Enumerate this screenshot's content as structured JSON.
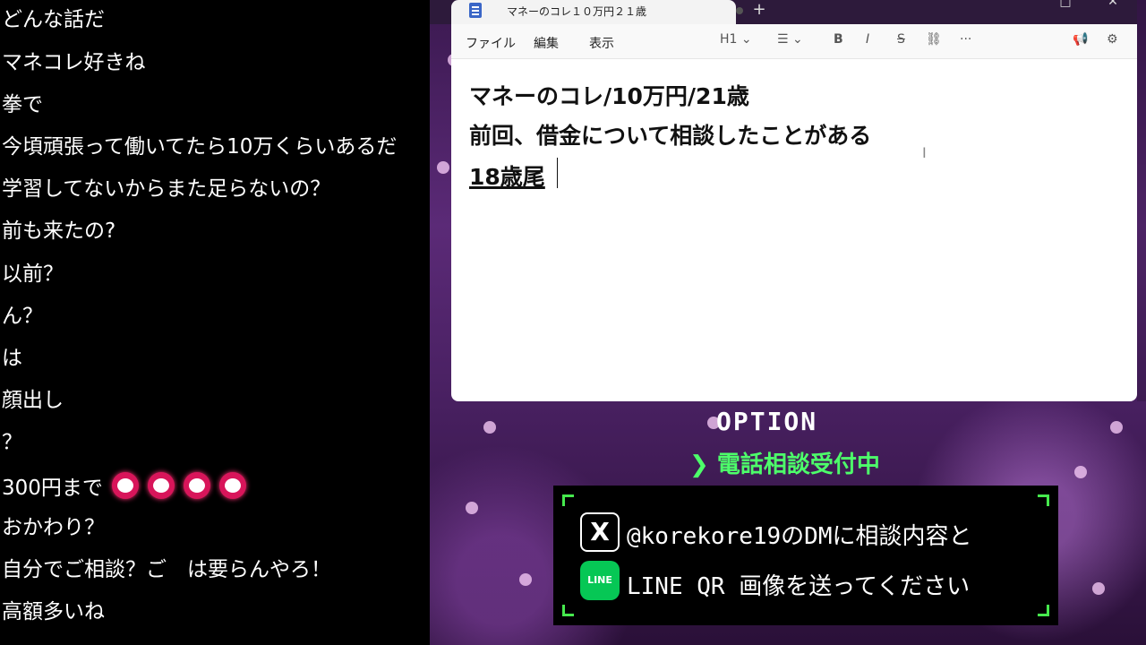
{
  "chat": {
    "lines": [
      "どんな話だ",
      "マネコレ好きね",
      "拳で",
      "今頃頑張って働いてたら10万くらいあるだ",
      "学習してないからまた足らないの？",
      "前も来たの?",
      "以前？",
      "ん？",
      "は",
      "顔出し",
      "？",
      "300円まで",
      "おかわり？",
      "自分でご相談？ご　は要らんやろ！",
      "高額多いね"
    ],
    "emoji_icon": "red-heart-sticker-icon"
  },
  "notepad": {
    "tab_title": "マネーのコレ１０万円２１歳",
    "new_tab": "+",
    "window_controls": [
      "□",
      "✕"
    ],
    "menu": [
      "ファイル",
      "編集",
      "表示"
    ],
    "toolbar": {
      "heading": "H1",
      "list_icon": "list-icon",
      "bold": "B",
      "italic": "I",
      "strikethrough": "S",
      "link_icon": "link-icon",
      "more": "···",
      "megaphone_icon": "megaphone-icon",
      "settings_icon": "gear-icon"
    },
    "content": [
      "マネーのコレ/10万円/21歳",
      "前回、借金について相談したことがある",
      "18歳尾"
    ]
  },
  "overlay": {
    "option_title": "OPTION",
    "phone_text": "❯ 電話相談受付中",
    "panel_line1": "@korekore19のDMに相談内容と",
    "panel_line2": "LINE QR 画像を送ってください",
    "x_logo": "X",
    "line_logo": "LINE",
    "accent": "#46e94d"
  }
}
